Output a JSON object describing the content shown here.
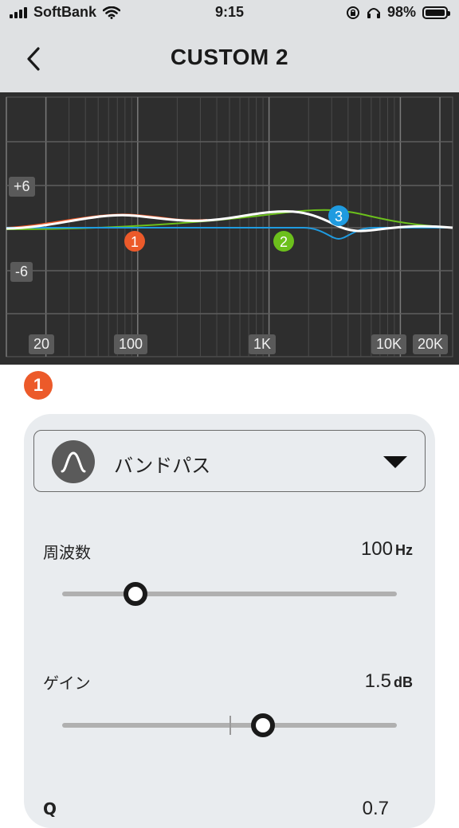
{
  "status": {
    "carrier": "SoftBank",
    "time": "9:15",
    "battery": "98%",
    "battery_level": 0.98
  },
  "header": {
    "title": "CUSTOM 2"
  },
  "graph": {
    "db_labels": [
      "+6",
      "-6"
    ],
    "freq_labels": [
      "20",
      "100",
      "1K",
      "10K",
      "20K"
    ],
    "bands": [
      {
        "number": "1",
        "color": "#ec5a2a"
      },
      {
        "number": "2",
        "color": "#6cc01c"
      },
      {
        "number": "3",
        "color": "#1f9be0"
      }
    ]
  },
  "selected_band": {
    "number": "1",
    "color": "#ec5a2a"
  },
  "filter": {
    "label": "バンドパス",
    "icon": "bandpass-curve-icon"
  },
  "params": {
    "frequency": {
      "label": "周波数",
      "value": "100",
      "unit": "Hz",
      "level": 0.22
    },
    "gain": {
      "label": "ゲイン",
      "value": "1.5",
      "unit": "dB",
      "level": 0.6
    },
    "q": {
      "label": "Q",
      "value": "0.7"
    }
  }
}
